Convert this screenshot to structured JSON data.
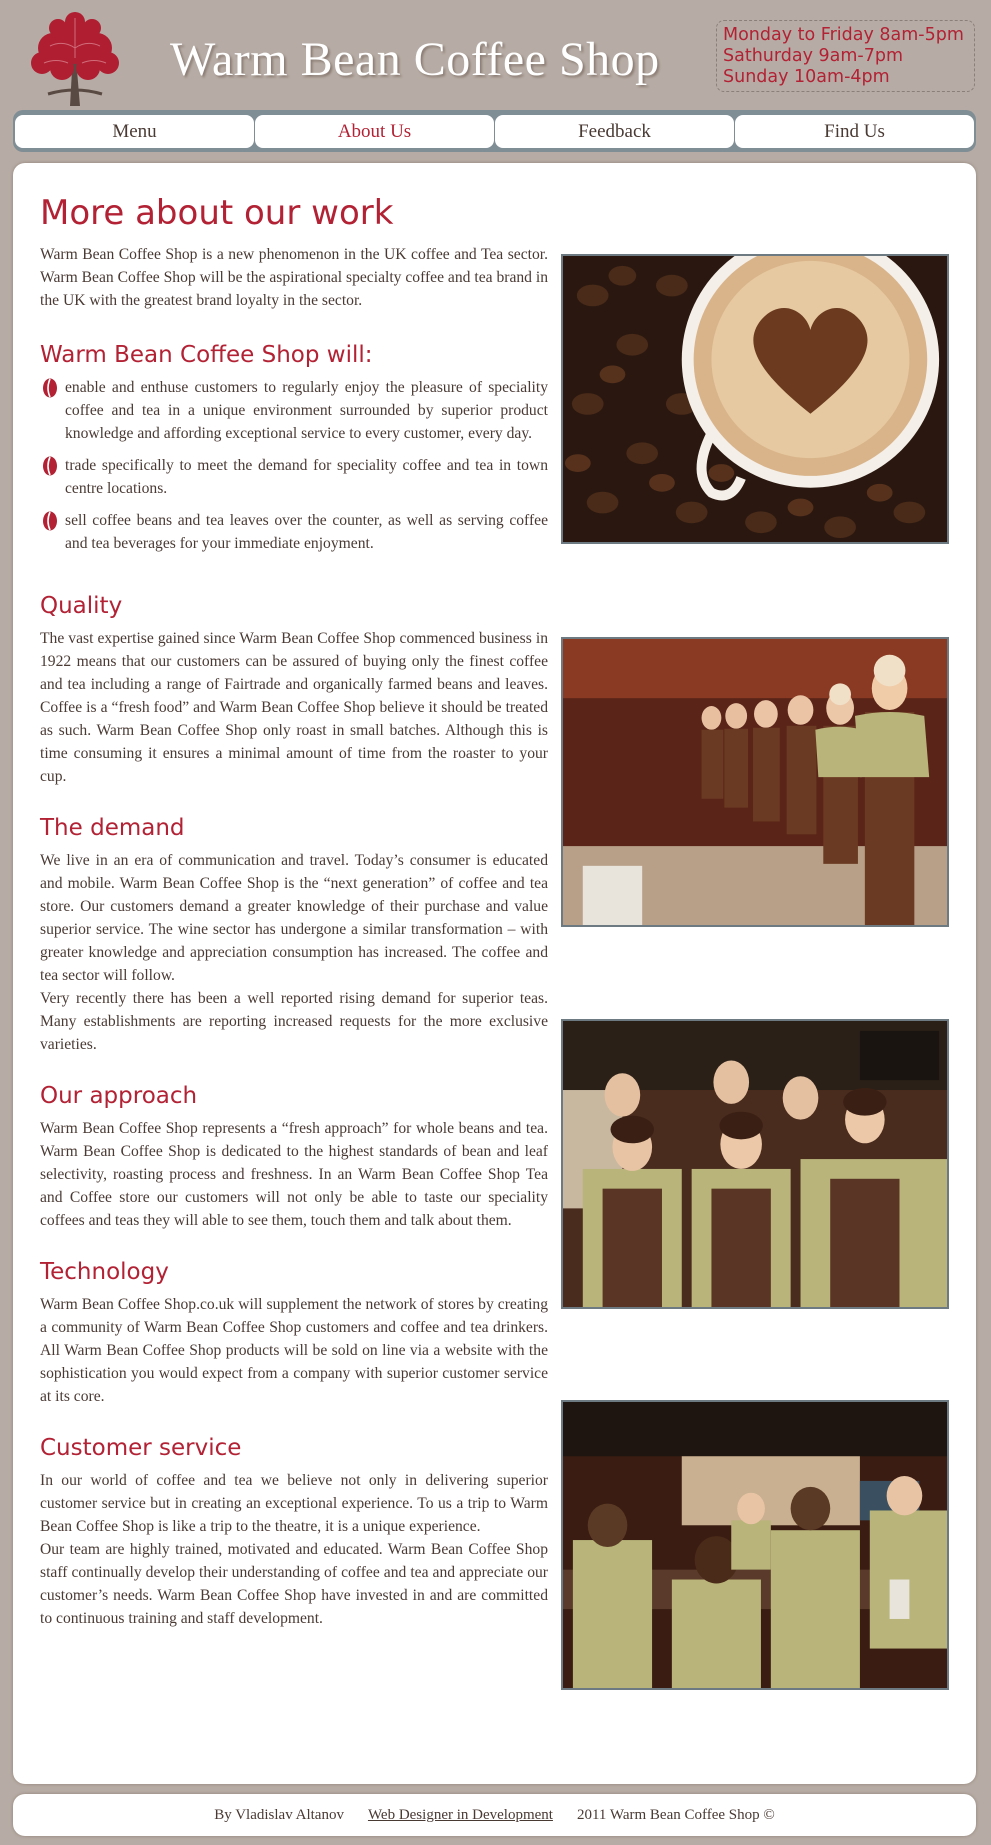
{
  "header": {
    "title": "Warm Bean Coffee Shop",
    "hours": [
      "Monday to Friday 8am-5pm",
      "Sathurday 9am-7pm",
      "Sunday 10am-4pm"
    ]
  },
  "nav": {
    "items": [
      {
        "label": "Menu"
      },
      {
        "label": "About Us",
        "active": true
      },
      {
        "label": "Feedback"
      },
      {
        "label": "Find Us"
      }
    ]
  },
  "main": {
    "heading": "More about our work",
    "intro": "Warm Bean Coffee Shop is a new phenomenon in the UK coffee and Tea sector. Warm Bean Coffee Shop will be the aspirational specialty coffee and tea brand in the UK with the greatest brand loyalty in the sector.",
    "will_heading": "Warm Bean Coffee Shop will:",
    "will_items": [
      "enable and enthuse customers to regularly enjoy the pleasure of speciality coffee and tea in a unique environment surrounded by superior product knowledge and affording exceptional service to every customer, every day.",
      "trade specifically to meet the demand for speciality coffee and tea in town centre locations.",
      "sell coffee beans and tea leaves over the counter, as well as serving coffee and tea beverages for your immediate enjoyment."
    ],
    "sections": [
      {
        "title": "Quality",
        "paragraphs": [
          "The vast expertise gained since Warm Bean Coffee Shop commenced business in 1922 means that our customers can be assured of buying only the finest coffee and tea including a range of Fairtrade and organically farmed beans and leaves. Coffee is a “fresh food” and Warm Bean Coffee Shop believe it should be treated as such. Warm Bean Coffee Shop only roast in small batches. Although this is time consuming it ensures a minimal amount of time from the roaster to your cup."
        ]
      },
      {
        "title": "The demand",
        "paragraphs": [
          "We live in an era of communication and travel. Today’s consumer is educated and mobile. Warm Bean Coffee Shop is the “next generation” of coffee and tea store. Our customers demand a greater knowledge of their purchase and value superior service. The wine sector has undergone a similar transformation – with greater knowledge and appreciation consumption has increased. The coffee and tea sector will follow.",
          "Very recently there has been a well reported rising demand for superior teas. Many establishments are reporting increased requests for the more exclusive varieties."
        ]
      },
      {
        "title": "Our approach",
        "paragraphs": [
          "Warm Bean Coffee Shop represents a “fresh approach” for whole beans and tea. Warm Bean Coffee Shop is dedicated to the highest standards of bean and leaf selectivity, roasting process and freshness. In an Warm Bean Coffee Shop Tea and Coffee store our customers will not only be able to taste our speciality coffees and teas they will able to see them, touch them and talk about them."
        ]
      },
      {
        "title": "Technology",
        "paragraphs": [
          "Warm Bean Coffee Shop.co.uk will supplement the network of stores by creating a community of Warm Bean Coffee Shop customers and coffee and tea drinkers. All Warm Bean Coffee Shop products will be sold on line via a website with the sophistication you would expect from a company with superior customer service at its core."
        ]
      },
      {
        "title": "Customer service",
        "paragraphs": [
          "In our world of coffee and tea we believe not only in delivering superior customer service but in creating an exceptional experience. To us a trip to Warm Bean Coffee Shop is like a trip to the theatre, it is a unique experience.",
          "Our team are highly trained, motivated and educated. Warm Bean Coffee Shop staff continually develop their understanding of coffee and tea and appreciate our customer’s needs. Warm Bean Coffee Shop have invested in and are committed to continuous training and staff development."
        ]
      }
    ]
  },
  "footer": {
    "author": "By Vladislav Altanov",
    "link": "Web Designer in Development",
    "copyright": "2011 Warm Bean Coffee Shop ©"
  },
  "colors": {
    "accent": "#b22234",
    "background": "#b7aca5",
    "text": "#4a3a34"
  }
}
